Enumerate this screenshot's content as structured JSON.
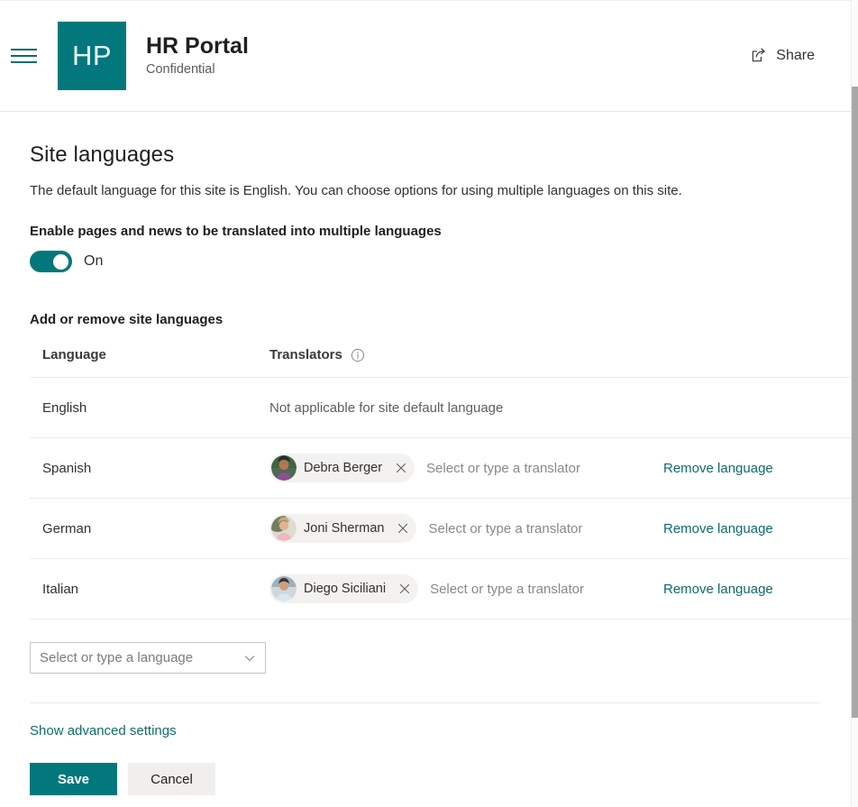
{
  "header": {
    "menu_icon": "hamburger-icon",
    "logo_initials": "HP",
    "site_title": "HR Portal",
    "site_subtitle": "Confidential",
    "share_label": "Share",
    "share_icon": "share-icon",
    "accent_color": "#03787c"
  },
  "main": {
    "page_title": "Site languages",
    "description": "The default language for this site is English. You can choose options for using multiple languages on this site.",
    "toggle_label": "Enable pages and news to be translated into multiple languages",
    "toggle_state": "On",
    "toggle_on": true,
    "section_label": "Add or remove site languages",
    "table": {
      "headers": {
        "language": "Language",
        "translators": "Translators",
        "info_icon": "info-circle-icon"
      },
      "rows": [
        {
          "language": "English",
          "translators_text": "Not applicable for site default language",
          "has_picker": false,
          "people": [],
          "action": ""
        },
        {
          "language": "Spanish",
          "translators_text": "",
          "has_picker": true,
          "people": [
            {
              "name": "Debra Berger",
              "avatar": "debra-berger-avatar"
            }
          ],
          "picker_placeholder": "Select or type a translator",
          "action": "Remove language"
        },
        {
          "language": "German",
          "translators_text": "",
          "has_picker": true,
          "people": [
            {
              "name": "Joni Sherman",
              "avatar": "joni-sherman-avatar"
            }
          ],
          "picker_placeholder": "Select or type a translator",
          "action": "Remove language"
        },
        {
          "language": "Italian",
          "translators_text": "",
          "has_picker": true,
          "people": [
            {
              "name": "Diego Siciliani",
              "avatar": "diego-siciliani-avatar"
            }
          ],
          "picker_placeholder": "Select or type a translator",
          "action": "Remove language"
        }
      ]
    },
    "add_language_placeholder": "Select or type a language",
    "advanced_settings_link": "Show advanced settings",
    "save_label": "Save",
    "cancel_label": "Cancel"
  },
  "colors": {
    "accent": "#03787c",
    "link": "#0f6b6b",
    "divider": "#edebe9",
    "chip_bg": "#f3f2f1",
    "secondary_btn": "#f1efee"
  }
}
